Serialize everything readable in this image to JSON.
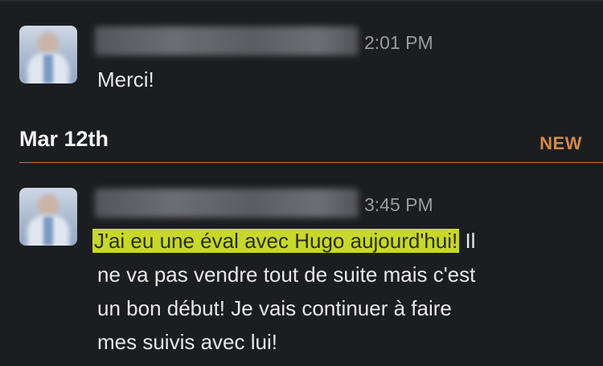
{
  "message1": {
    "time": "2:01 PM",
    "text": "Merci!"
  },
  "divider": {
    "date": "Mar 12th",
    "new_label": "NEW",
    "accent_color": "#d28a44"
  },
  "message2": {
    "time": "3:45 PM",
    "highlighted_text": "J'ai eu une éval avec Hugo aujourd'hui!",
    "rest_line1": " Il",
    "line2": "ne va pas vendre tout de suite mais c'est",
    "line3": "un bon début! Je vais continuer à faire",
    "line4": "mes suivis avec lui!",
    "highlight_color": "#c7d82a"
  }
}
